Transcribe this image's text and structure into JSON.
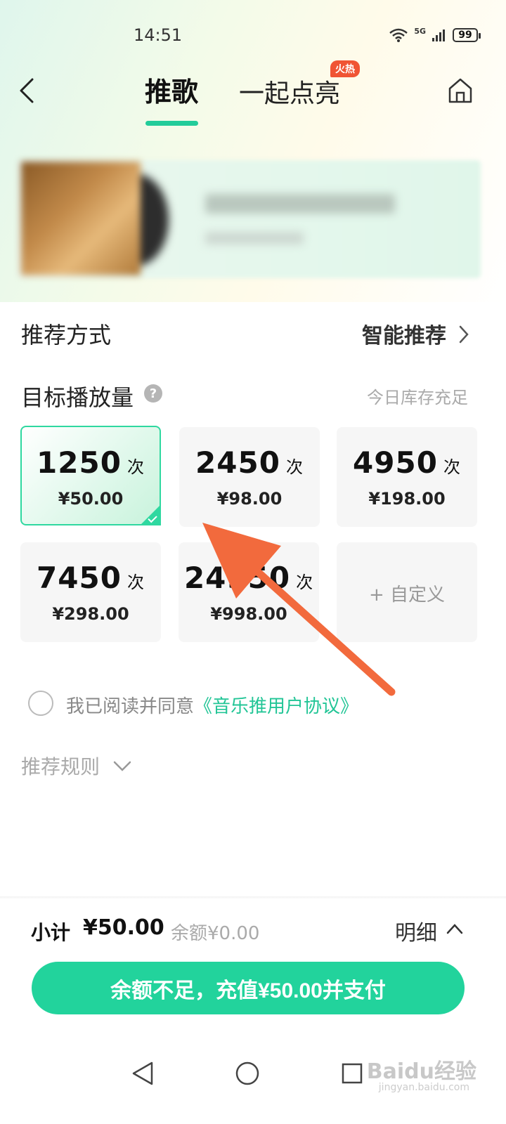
{
  "status_bar": {
    "time": "14:51",
    "network": "5G",
    "battery": "99"
  },
  "nav": {
    "tab_active": "推歌",
    "tab_other": "一起点亮",
    "hot_badge": "火热"
  },
  "recommend_method": {
    "label": "推荐方式",
    "value": "智能推荐"
  },
  "target_plays": {
    "label": "目标播放量",
    "help": "?",
    "stock": "今日库存充足",
    "unit": "次",
    "options": [
      {
        "count": "1250",
        "price": "¥50.00",
        "selected": true
      },
      {
        "count": "2450",
        "price": "¥98.00",
        "selected": false
      },
      {
        "count": "4950",
        "price": "¥198.00",
        "selected": false
      },
      {
        "count": "7450",
        "price": "¥298.00",
        "selected": false
      },
      {
        "count": "24950",
        "price": "¥998.00",
        "selected": false
      }
    ],
    "custom_label": "+ 自定义"
  },
  "agreement": {
    "text": "我已阅读并同意",
    "link": "《音乐推用户协议》"
  },
  "rules": {
    "label": "推荐规则"
  },
  "footer": {
    "subtotal_label": "小计",
    "subtotal_value": "¥50.00",
    "balance": "余额¥0.00",
    "detail": "明细",
    "pay_button": "余额不足，充值¥50.00并支付"
  },
  "watermark": {
    "brand": "Baidu经验",
    "url": "jingyan.baidu.com"
  },
  "colors": {
    "accent": "#22d39c",
    "hot": "#f05434",
    "arrow": "#f26a3d"
  }
}
